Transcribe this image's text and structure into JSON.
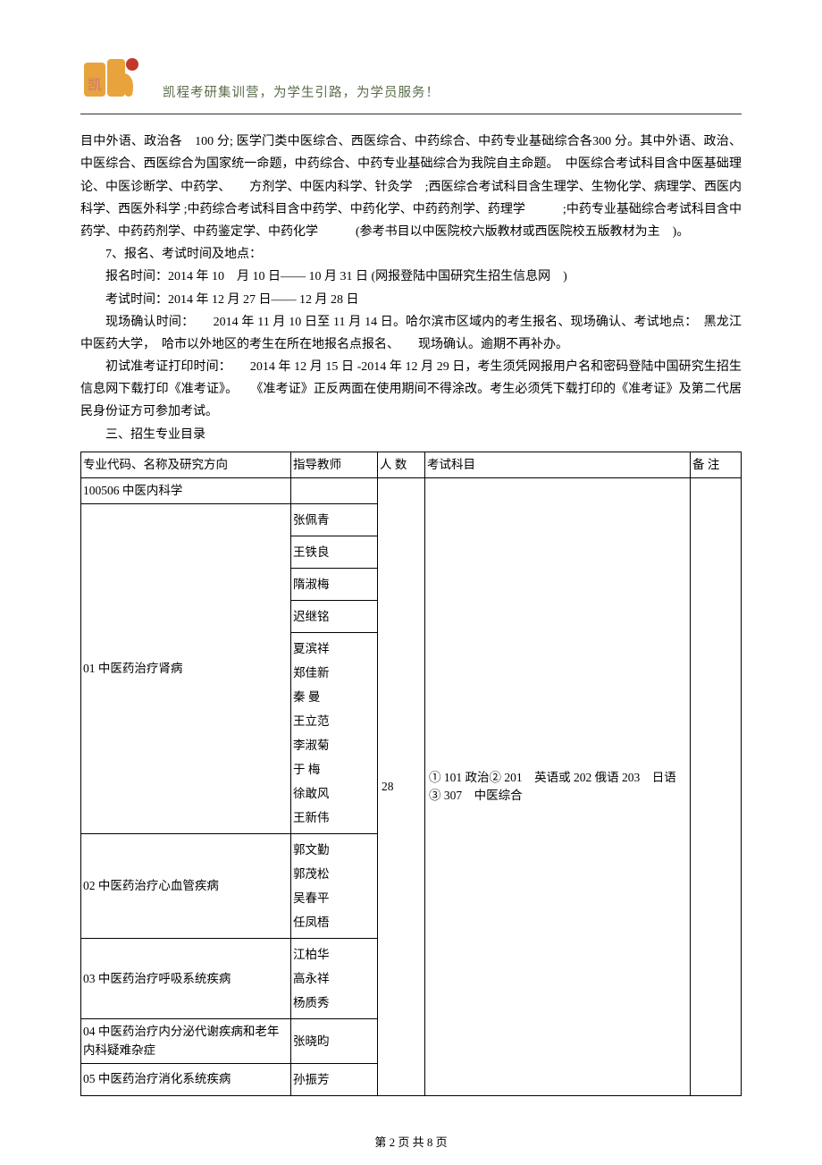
{
  "header": {
    "slogan": "凯程考研集训营，为学生引路，为学员服务！"
  },
  "body": {
    "p1": "目中外语、政治各　100 分; 医学门类中医综合、西医综合、中药综合、中药专业基础综合各300 分。其中外语、政治、中医综合、西医综合为国家统一命题，中药综合、中药专业基础综合为我院自主命题。　中医综合考试科目含中医基础理论、中医诊断学、中药学、　　方剂学、中医内科学、针灸学　;西医综合考试科目含生理学、生物化学、病理学、西医内科学、西医外科学 ;中药综合考试科目含中药学、中药化学、中药药剂学、药理学　　　;中药专业基础综合考试科目含中药学、中药药剂学、中药鉴定学、中药化学　　　(参考书目以中医院校六版教材或西医院校五版教材为主　)。",
    "p2": "7、报名、考试时间及地点：",
    "p3": "报名时间：2014 年 10　月 10 日—— 10 月 31 日 (网报登陆中国研究生招生信息网　)",
    "p4": "考试时间：2014 年 12 月 27 日—— 12 月 28 日",
    "p5": "现场确认时间：　　2014 年 11 月 10 日至 11 月 14 日。哈尔滨市区域内的考生报名、现场确认、考试地点：　黑龙江中医药大学，　哈市以外地区的考生在所在地报名点报名、　　现场确认。逾期不再补办。",
    "p6": "初试准考证打印时间：　　2014 年 12 月 15 日 -2014 年 12 月 29 日，考生须凭网报用户名和密码登陆中国研究生招生信息网下载打印《准考证》。　　《准考证》正反两面在使用期间不得涂改。考生必须凭下载打印的《准考证》及第二代居民身份证方可参加考试。",
    "p7": "三、招生专业目录"
  },
  "table": {
    "headers": {
      "col1": "专业代码、名称及研究方向",
      "col2": "指导教师",
      "col3": "人 数",
      "col4": "考试科目",
      "col5": "备 注"
    },
    "rows": {
      "major": "100506 中医内科学",
      "dir01": "01 中医药治疗肾病",
      "dir02": "02 中医药治疗心血管疾病",
      "dir03": "03 中医药治疗呼吸系统疾病",
      "dir04": "04 中医药治疗内分泌代谢疾病和老年内科疑难杂症",
      "dir05": "05 中医药治疗消化系统疾病",
      "teachers01a": "张佩青",
      "teachers01b": "王铁良",
      "teachers01c": "隋淑梅",
      "teachers01d": "迟继铭",
      "teachers01e": "夏滨祥\n郑佳新\n秦 曼\n王立范\n李淑菊\n于 梅\n徐敢风\n王新伟",
      "t02": "郭文勤\n郭茂松\n吴春平\n任凤梧",
      "t03": "江柏华\n高永祥\n杨质秀",
      "t04": "张晓昀",
      "t05": "孙振芳",
      "count": "28",
      "subjects": "① 101 政治② 201　英语或 202 俄语 203　日语③ 307　中医综合"
    }
  },
  "footer": {
    "page": "第 2 页 共 8 页"
  }
}
